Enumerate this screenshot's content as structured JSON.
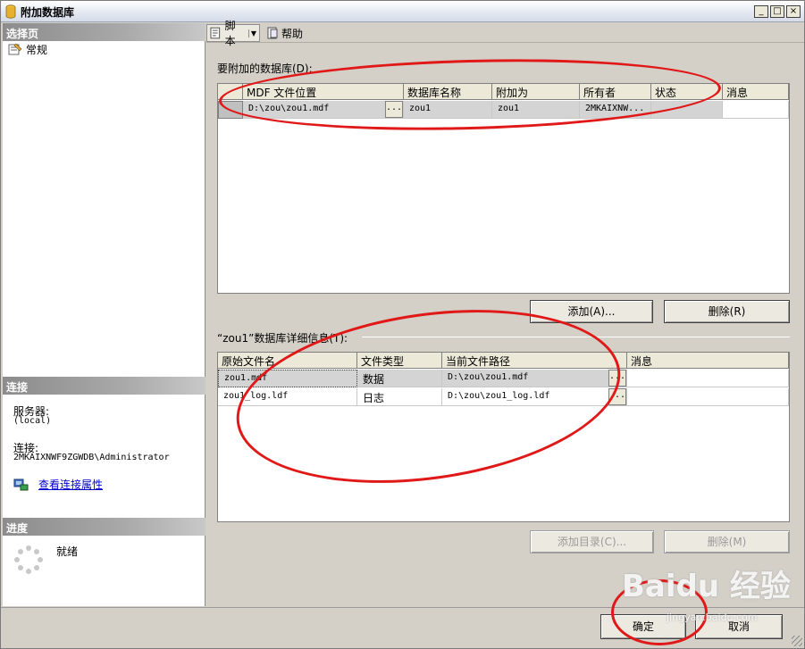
{
  "window": {
    "title": "附加数据库",
    "controls": [
      "_",
      "□",
      "×"
    ]
  },
  "left": {
    "select_page_header": "选择页",
    "pages": [
      {
        "label": "常规",
        "icon": "properties-page-icon"
      }
    ],
    "connection_header": "连接",
    "server_label": "服务器:",
    "server_value": "(local)",
    "connection_label": "连接:",
    "connection_value": "2MKAIXNWF9ZGWDB\\Administrator",
    "view_connection_link": "查看连接属性",
    "progress_header": "进度",
    "progress_status": "就绪"
  },
  "toolbar": {
    "script_label": "脚本",
    "help_label": "帮助"
  },
  "databases": {
    "group_label": "要附加的数据库(D):",
    "columns": [
      "",
      "MDF 文件位置",
      "数据库名称",
      "附加为",
      "所有者",
      "状态",
      "消息"
    ],
    "rows": [
      {
        "mdf": "D:\\zou\\zou1.mdf",
        "ellipsis": "...",
        "name": "zou1",
        "attach_as": "zou1",
        "owner": "2MKAIXNW...",
        "status": "",
        "message": ""
      }
    ],
    "add_button": "添加(A)...",
    "remove_button": "删除(R)"
  },
  "details": {
    "group_label": "“zou1”数据库详细信息(T):",
    "columns": [
      "原始文件名",
      "文件类型",
      "当前文件路径",
      "消息"
    ],
    "rows": [
      {
        "filename": "zou1.mdf",
        "type": "数据",
        "path": "D:\\zou\\zou1.mdf",
        "ellipsis": "...",
        "message": ""
      },
      {
        "filename": "zou1_log.ldf",
        "type": "日志",
        "path": "D:\\zou\\zou1_log.ldf",
        "ellipsis": "...",
        "message": ""
      }
    ],
    "add_catalog_button": "添加目录(C)...",
    "remove_button": "删除(M)"
  },
  "footer": {
    "ok_button": "确定",
    "cancel_button": "取消"
  },
  "watermark": {
    "brand": "Baidu 经验",
    "url": "jingyan.baidu.com"
  },
  "colors": {
    "annotation": "#e01818",
    "link": "#0000cc",
    "dialog_bg": "#d4d0c8"
  }
}
